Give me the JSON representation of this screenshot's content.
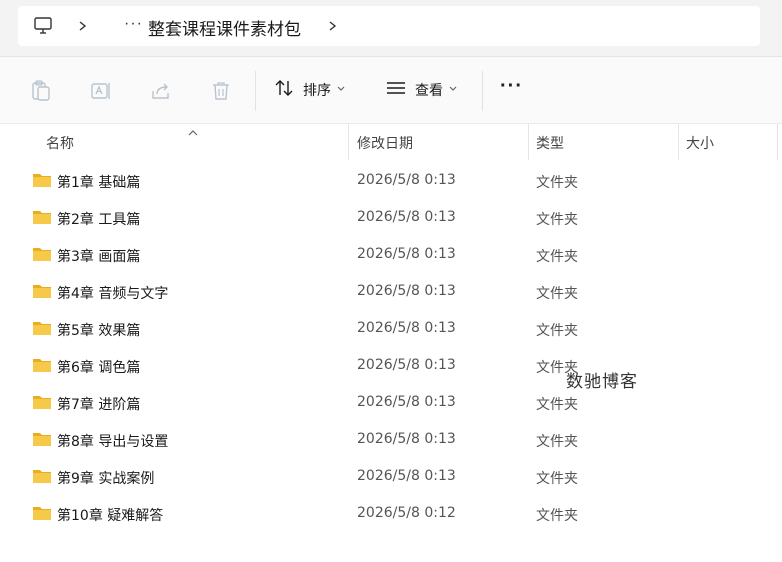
{
  "address_bar": {
    "more": "···",
    "path": "整套课程课件素材包"
  },
  "toolbar": {
    "sort_label": "排序",
    "view_label": "查看",
    "more": "···"
  },
  "columns": {
    "name": "名称",
    "modified": "修改日期",
    "type": "类型",
    "size": "大小"
  },
  "files": [
    {
      "name": "第1章 基础篇",
      "modified": "2026/5/8 0:13",
      "type": "文件夹"
    },
    {
      "name": "第2章 工具篇",
      "modified": "2026/5/8 0:13",
      "type": "文件夹"
    },
    {
      "name": "第3章 画面篇",
      "modified": "2026/5/8 0:13",
      "type": "文件夹"
    },
    {
      "name": "第4章 音频与文字",
      "modified": "2026/5/8 0:13",
      "type": "文件夹"
    },
    {
      "name": "第5章 效果篇",
      "modified": "2026/5/8 0:13",
      "type": "文件夹"
    },
    {
      "name": "第6章 调色篇",
      "modified": "2026/5/8 0:13",
      "type": "文件夹"
    },
    {
      "name": "第7章 进阶篇",
      "modified": "2026/5/8 0:13",
      "type": "文件夹"
    },
    {
      "name": "第8章 导出与设置",
      "modified": "2026/5/8 0:13",
      "type": "文件夹"
    },
    {
      "name": "第9章 实战案例",
      "modified": "2026/5/8 0:13",
      "type": "文件夹"
    },
    {
      "name": "第10章 疑难解答",
      "modified": "2026/5/8 0:12",
      "type": "文件夹"
    }
  ],
  "watermark": "数驰博客",
  "colors": {
    "folder": "#F7C948",
    "folder_dark": "#E8AE1F",
    "toolbar_bg": "#fafafa",
    "topbar_bg": "#f3f3f3"
  }
}
